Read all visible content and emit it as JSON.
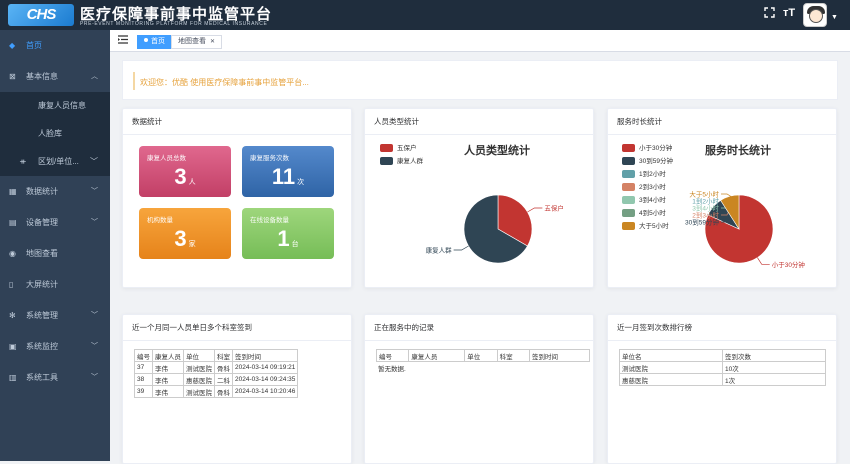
{
  "brand": {
    "logo_text": "CHS",
    "title": "医疗保障事前事中监管平台",
    "subtitle": "PRE-EVENT MONITORING PLATFORM FOR MEDICAL INSURANCE"
  },
  "topbar": {
    "fullscreen_icon": "expand-icon",
    "fontsize_icon": "font-size-icon",
    "fontsize_glyph": "тT",
    "avatar_icon": "user-avatar-icon"
  },
  "sidebar": {
    "items": [
      {
        "label": "首页",
        "icon": "dashboard-icon"
      },
      {
        "label": "基本信息",
        "icon": "info-icon"
      },
      {
        "label": "康复人员信息"
      },
      {
        "label": "人脸库"
      },
      {
        "label": "区划/单位...",
        "icon": "tree-icon"
      },
      {
        "label": "数据统计",
        "icon": "table-icon"
      },
      {
        "label": "设备管理",
        "icon": "document-icon"
      },
      {
        "label": "地图查看",
        "icon": "eye-icon"
      },
      {
        "label": "大屏统计",
        "icon": "book-icon"
      },
      {
        "label": "系统管理",
        "icon": "gear-icon"
      },
      {
        "label": "系统监控",
        "icon": "monitor-icon"
      },
      {
        "label": "系统工具",
        "icon": "toolbox-icon"
      }
    ]
  },
  "tabs": [
    {
      "label": "首页"
    },
    {
      "label": "地图查看"
    }
  ],
  "welcome": "欢迎您：优酷 使用医疗保障事前事中监管平台...",
  "stats_card": {
    "title": "数据统计",
    "items": [
      {
        "label": "康复人员总数",
        "value": "3",
        "unit": "人",
        "color": "#d9587f"
      },
      {
        "label": "康复服务次数",
        "value": "11",
        "unit": "次",
        "color": "#4a7dbf"
      },
      {
        "label": "机构数量",
        "value": "3",
        "unit": "家",
        "color": "#f39c2f"
      },
      {
        "label": "在线设备数量",
        "value": "1",
        "unit": "台",
        "color": "#8cca6a"
      }
    ]
  },
  "person_type_card": {
    "title": "人员类型统计",
    "chart_title": "人员类型统计",
    "legend": [
      {
        "name": "五保户",
        "color": "#c23531"
      },
      {
        "name": "康复人群",
        "color": "#2f4554"
      }
    ]
  },
  "duration_card": {
    "title": "服务时长统计",
    "chart_title": "服务时长统计",
    "legend": [
      {
        "name": "小于30分钟",
        "color": "#c23531"
      },
      {
        "name": "30到59分钟",
        "color": "#2f4554"
      },
      {
        "name": "1到2小时",
        "color": "#61a0a8"
      },
      {
        "name": "2到3小时",
        "color": "#d48265"
      },
      {
        "name": "3到4小时",
        "color": "#91c7ae"
      },
      {
        "name": "4到5小时",
        "color": "#749f83"
      },
      {
        "name": "大于5小时",
        "color": "#ca8622"
      }
    ]
  },
  "chart_data": [
    {
      "type": "pie",
      "title": "人员类型统计",
      "series": [
        {
          "values": [
            {
              "name": "五保户",
              "value": 1
            },
            {
              "name": "康复人群",
              "value": 2
            }
          ]
        }
      ]
    },
    {
      "type": "pie",
      "title": "服务时长统计",
      "series": [
        {
          "values": [
            {
              "name": "小于30分钟",
              "value": 9
            },
            {
              "name": "30到59分钟",
              "value": 1
            },
            {
              "name": "1到2小时",
              "value": 0
            },
            {
              "name": "2到3小时",
              "value": 0
            },
            {
              "name": "3到4小时",
              "value": 0
            },
            {
              "name": "4到5小时",
              "value": 0
            },
            {
              "name": "大于5小时",
              "value": 1
            }
          ]
        }
      ]
    }
  ],
  "month_card": {
    "title": "近一个月同一人员单日多个科室签到",
    "columns": [
      "编号",
      "康复人员",
      "单位",
      "科室",
      "签到时间"
    ],
    "rows": [
      [
        "37",
        "李伟",
        "测试医院",
        "骨科",
        "2024-03-14 09:19:21"
      ],
      [
        "38",
        "李伟",
        "惠慈医院",
        "二科",
        "2024-03-14 09:24:35"
      ],
      [
        "39",
        "李伟",
        "测试医院",
        "骨科",
        "2024-03-14 10:20:46"
      ]
    ]
  },
  "serving_card": {
    "title": "正在服务中的记录",
    "columns": [
      "编号",
      "康复人员",
      "单位",
      "科室",
      "签到时间"
    ],
    "empty": "暂无数据."
  },
  "rank_card": {
    "title": "近一月签到次数排行榜",
    "columns": [
      "单位名",
      "签到次数"
    ],
    "rows": [
      [
        "测试医院",
        "10次"
      ],
      [
        "惠慈医院",
        "1次"
      ]
    ]
  }
}
